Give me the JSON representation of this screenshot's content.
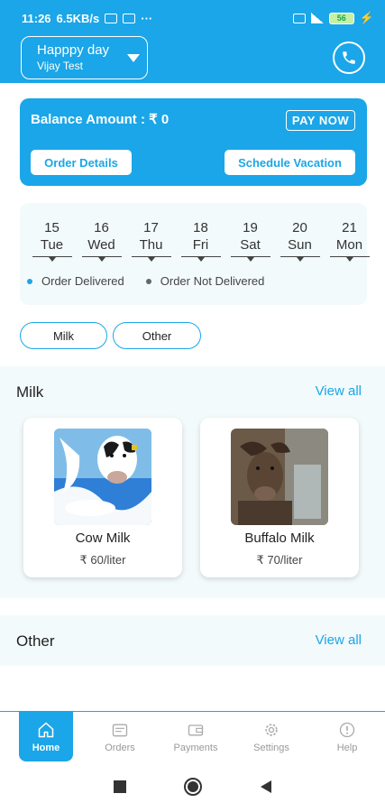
{
  "status_bar": {
    "time": "11:26",
    "speed": "6.5KB/s",
    "dots": "···",
    "battery": "56"
  },
  "header": {
    "location_title": "Happpy day",
    "location_subtitle": "Vijay Test"
  },
  "balance": {
    "label": "Balance Amount : ₹ 0",
    "pay_now": "PAY NOW",
    "order_details": "Order Details",
    "schedule_vacation": "Schedule Vacation"
  },
  "calendar": {
    "days": [
      {
        "num": "15",
        "name": "Tue"
      },
      {
        "num": "16",
        "name": "Wed"
      },
      {
        "num": "17",
        "name": "Thu"
      },
      {
        "num": "18",
        "name": "Fri"
      },
      {
        "num": "19",
        "name": "Sat"
      },
      {
        "num": "20",
        "name": "Sun"
      },
      {
        "num": "21",
        "name": "Mon"
      }
    ],
    "legend_delivered": "Order Delivered",
    "legend_not_delivered": "Order Not Delivered",
    "delivered_color": "#1aa6e8",
    "not_delivered_color": "#666666"
  },
  "filters": {
    "milk": "Milk",
    "other": "Other"
  },
  "milk_section": {
    "title": "Milk",
    "view_all": "View all",
    "products": [
      {
        "name": "Cow Milk",
        "price": "₹ 60/liter"
      },
      {
        "name": "Buffalo Milk",
        "price": "₹ 70/liter"
      }
    ]
  },
  "other_section": {
    "title": "Other",
    "view_all": "View all"
  },
  "bottom_nav": {
    "home": "Home",
    "orders": "Orders",
    "payments": "Payments",
    "settings": "Settings",
    "help": "Help"
  },
  "colors": {
    "accent": "#1aa6e8",
    "surface": "#f3fafb"
  }
}
